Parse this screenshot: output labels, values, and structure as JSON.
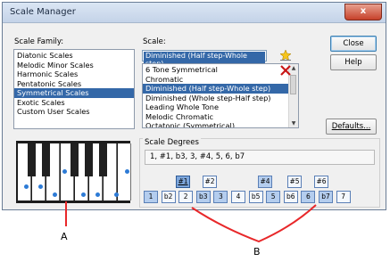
{
  "window": {
    "title": "Scale Manager",
    "close_glyph": "x"
  },
  "family": {
    "label": "Scale Family:",
    "items": [
      "Diatonic Scales",
      "Melodic Minor Scales",
      "Harmonic Scales",
      "Pentatonic Scales",
      "Symmetrical Scales",
      "Exotic Scales",
      "Custom User Scales"
    ],
    "selected_index": 4
  },
  "scale": {
    "label": "Scale:",
    "combo_value": "Diminished (Half step-Whole step)",
    "items": [
      "6 Tone Symmetrical",
      "Chromatic",
      "Diminished (Half step-Whole step)",
      "Diminished (Whole step-Half step)",
      "Leading Whole Tone",
      "Melodic Chromatic",
      "Octatonic (Symmetrical)"
    ],
    "selected_index": 2
  },
  "buttons": {
    "close": "Close",
    "help": "Help",
    "defaults": "Defaults..."
  },
  "degrees": {
    "label": "Scale Degrees",
    "value": "1, #1, b3, 3, #4, 5, 6, b7",
    "top_row": [
      "#1",
      "#2",
      "#4",
      "#5",
      "#6"
    ],
    "top_active": [
      true,
      false,
      true,
      false,
      false
    ],
    "bottom_row": [
      "1",
      "b2",
      "2",
      "b3",
      "3",
      "4",
      "b5",
      "5",
      "b6",
      "6",
      "b7",
      "7"
    ],
    "bottom_active": [
      true,
      false,
      false,
      true,
      true,
      false,
      false,
      true,
      false,
      true,
      true,
      false
    ]
  },
  "callouts": {
    "a": "A",
    "b": "B"
  },
  "colors": {
    "selection": "#3468a8",
    "accent_red": "#e8282a",
    "dot_blue": "#2d7bd6"
  }
}
